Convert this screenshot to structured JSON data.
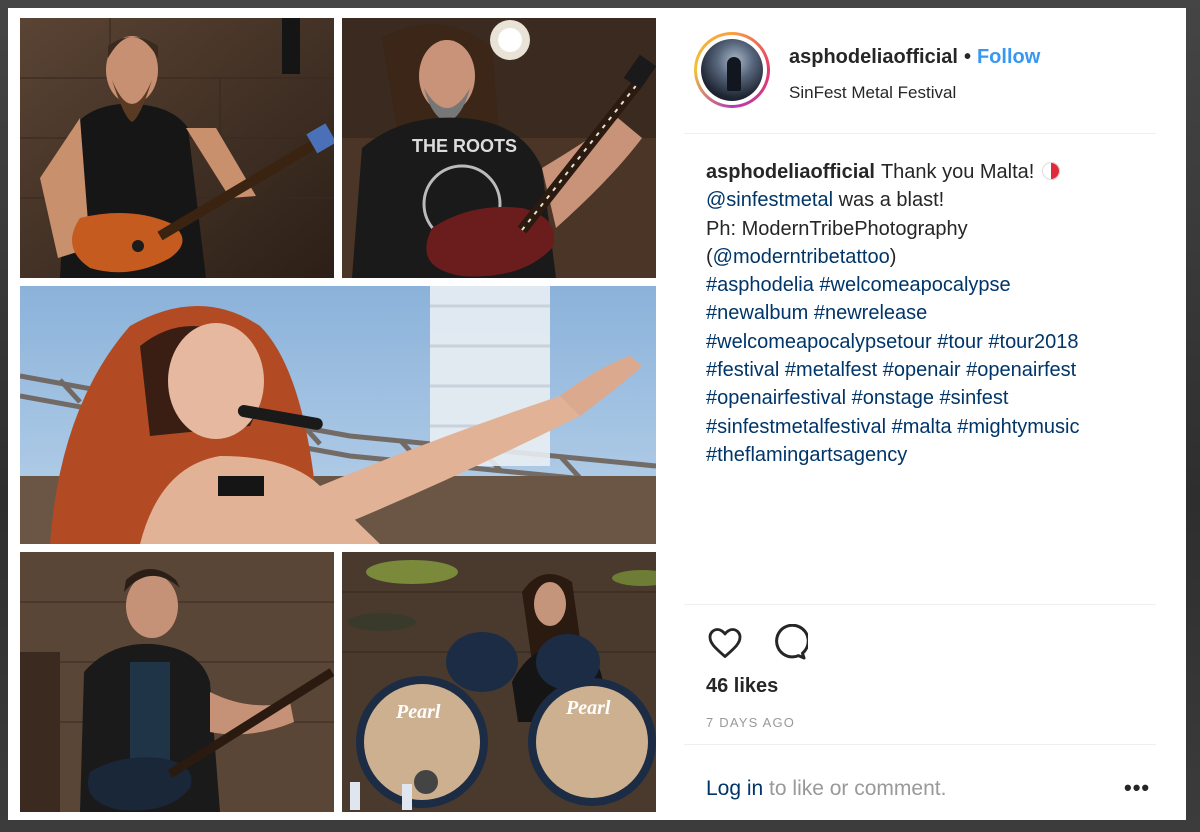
{
  "post": {
    "username": "asphodeliaofficial",
    "separator": "•",
    "follow_label": "Follow",
    "location": "SinFest Metal Festival"
  },
  "caption": {
    "username": "asphodeliaofficial",
    "line1_text": "Thank you Malta!",
    "mention1": "@sinfestmetal",
    "line2_text": " was a blast!",
    "line3_text": "Ph: ModernTribePhotography",
    "mention2_open": "(",
    "mention2": "@moderntribetattoo",
    "mention2_close": ")",
    "hashtag_lines": [
      "#asphodelia #welcomeapocalypse",
      "#newalbum #newrelease",
      "#welcomeapocalypsetour #tour #tour2018",
      "#festival #metalfest #openair #openairfest",
      "#openairfestival #onstage #sinfest",
      "#sinfestmetalfestival #malta #mightymusic",
      "#theflamingartsagency"
    ]
  },
  "actions": {
    "like_icon": "heart-icon",
    "comment_icon": "comment-icon",
    "likes": "46 likes",
    "timestamp": "7 DAYS AGO"
  },
  "footer": {
    "login_link": "Log in",
    "login_text": " to like or comment.",
    "more": "•••"
  },
  "photos": {
    "drum_brand_1": "Pearl",
    "drum_brand_2": "Pearl",
    "shirt_text": "THE ROOTS"
  },
  "colors": {
    "link": "#003569",
    "follow": "#3897f0",
    "text": "#262626",
    "muted": "#999999"
  }
}
